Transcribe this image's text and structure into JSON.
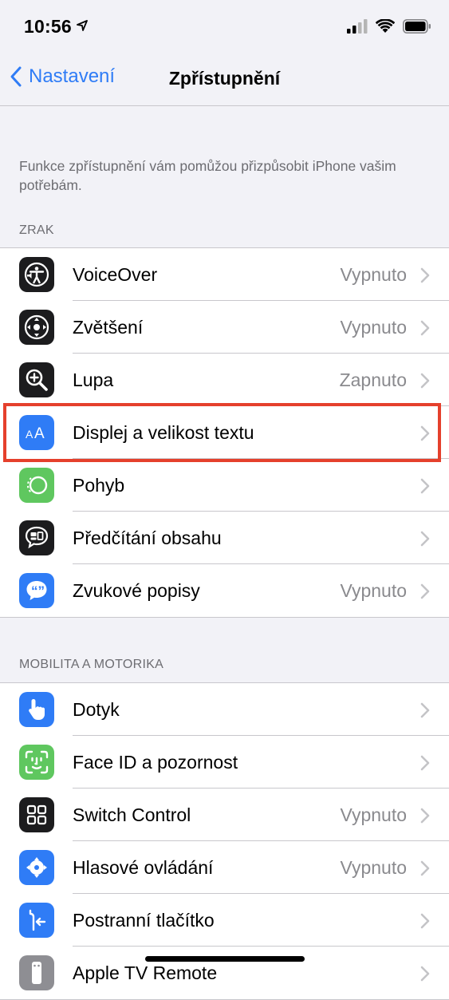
{
  "status": {
    "time": "10:56"
  },
  "nav": {
    "back_label": "Nastavení",
    "title": "Zpřístupnění"
  },
  "intro": "Funkce zpřístupnění vám pomůžou přizpůsobit iPhone vašim potřebám.",
  "colors": {
    "accent": "#2f7cf6",
    "highlight": "#e5402c"
  },
  "sections": [
    {
      "header": "ZRAK",
      "items": [
        {
          "label": "VoiceOver",
          "value": "Vypnuto",
          "icon": "voiceover-icon"
        },
        {
          "label": "Zvětšení",
          "value": "Vypnuto",
          "icon": "zoom-icon"
        },
        {
          "label": "Lupa",
          "value": "Zapnuto",
          "icon": "magnifier-icon"
        },
        {
          "label": "Displej a velikost textu",
          "value": "",
          "icon": "text-size-icon"
        },
        {
          "label": "Pohyb",
          "value": "",
          "icon": "motion-icon"
        },
        {
          "label": "Předčítání obsahu",
          "value": "",
          "icon": "spoken-content-icon"
        },
        {
          "label": "Zvukové popisy",
          "value": "Vypnuto",
          "icon": "audio-description-icon"
        }
      ]
    },
    {
      "header": "MOBILITA A MOTORIKA",
      "items": [
        {
          "label": "Dotyk",
          "value": "",
          "icon": "touch-icon"
        },
        {
          "label": "Face ID a pozornost",
          "value": "",
          "icon": "face-id-icon"
        },
        {
          "label": "Switch Control",
          "value": "Vypnuto",
          "icon": "switch-control-icon"
        },
        {
          "label": "Hlasové ovládání",
          "value": "Vypnuto",
          "icon": "voice-control-icon"
        },
        {
          "label": "Postranní tlačítko",
          "value": "",
          "icon": "side-button-icon"
        },
        {
          "label": "Apple TV Remote",
          "value": "",
          "icon": "tv-remote-icon"
        }
      ]
    }
  ]
}
